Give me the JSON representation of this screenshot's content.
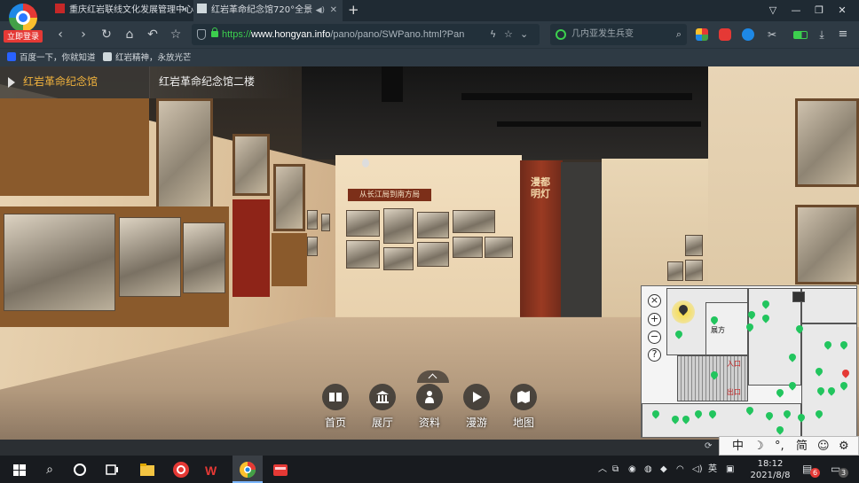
{
  "browser": {
    "login_badge": "立即登录",
    "tabs": [
      {
        "title": "重庆红岩联线文化发展管理中心",
        "active": false
      },
      {
        "title": "红岩革命纪念馆720°全景",
        "active": true
      }
    ],
    "new_tab": "+",
    "address": {
      "protocol": "https://",
      "domain": "www.hongyan.info",
      "path": "/pano/pano/SWPano.html?Pan"
    },
    "search": {
      "placeholder": "几内亚发生兵变"
    },
    "bookmarks": [
      {
        "label": "百度一下，你就知道"
      },
      {
        "label": "红岩精神，永放光芒"
      }
    ]
  },
  "pano": {
    "breadcrumb": {
      "primary": "红岩革命纪念馆",
      "secondary": "红岩革命纪念馆二楼"
    },
    "exhibit_sign": "从长江局到南方局",
    "pillar_text": "漫都明灯",
    "map_labels": {
      "hall": "展方",
      "entrance": "入口",
      "exit": "出口"
    },
    "menu": [
      {
        "label": "首页",
        "icon": "book-icon"
      },
      {
        "label": "展厅",
        "icon": "museum-icon"
      },
      {
        "label": "资料",
        "icon": "person-icon"
      },
      {
        "label": "漫游",
        "icon": "play-icon"
      },
      {
        "label": "地图",
        "icon": "map-icon"
      }
    ],
    "minimap_controls": {
      "close": "×",
      "zoom_in": "+",
      "zoom_out": "−",
      "help": "?"
    }
  },
  "ime": {
    "lang": "中",
    "moon": "☽",
    "punct": "°,",
    "mode": "简",
    "emoji": "☺",
    "settings": "⚙"
  },
  "taskbar": {
    "ime_lang": "英",
    "time": "18:12",
    "date": "2021/8/8",
    "notif_count": "6",
    "msg_count": "3"
  }
}
